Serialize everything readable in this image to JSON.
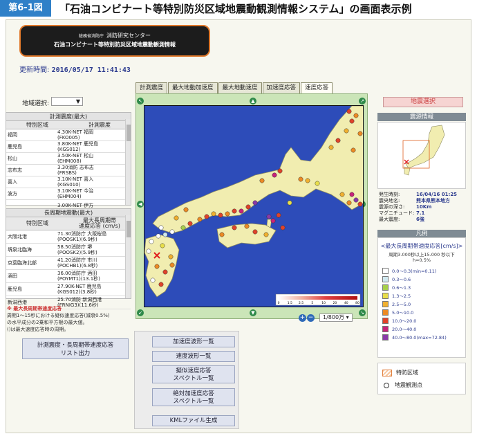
{
  "figure": {
    "tag": "第6-1図",
    "title": "「石油コンビナート等特別防災区域地震動観測情報システム」の画面表示例"
  },
  "banner": {
    "agency": "総務省消防庁",
    "org": "消防研究センター",
    "system": "石油コンビナート等特別防災区域地震動観測情報"
  },
  "updated": {
    "label": "更新時間:",
    "value": "2016/05/17 11:41:43"
  },
  "region_select": {
    "label": "地域選択:",
    "value": "▼"
  },
  "table1": {
    "caption": "計測震度(最大)",
    "headers": [
      "特別区域",
      "計測震度"
    ],
    "rows": [
      {
        "area": "福岡",
        "value": "4.30K-NET 福岡\n(FKO005)"
      },
      {
        "area": "鹿児島",
        "value": "3.80K-NET 鹿児島\n(KGS012)"
      },
      {
        "area": "松山",
        "value": "3.50K-NET 松山\n(EHM008)"
      },
      {
        "area": "志布志",
        "value": "3.30消防 志布志\n(FRSBS)"
      },
      {
        "area": "喜入",
        "value": "3.10K-NET 喜入\n(KGS010)"
      },
      {
        "area": "波方",
        "value": "3.10K-NET 今治\n(EHM004)"
      },
      {
        "area": "",
        "value": "3.00K-NET 伊方"
      }
    ]
  },
  "table2": {
    "caption": "長周期地震動(最大)",
    "headers": [
      "特別区域",
      "最大長周期帯\n速度応答 (cm/s)"
    ],
    "rows": [
      {
        "area": "大阪北港",
        "value": "71.30消防庁 大阪桜島\n(POOSK1)(6.9秒)"
      },
      {
        "area": "堺泉北臨海",
        "value": "58.50消防庁 堺\n(POOSK2)(5.9秒)"
      },
      {
        "area": "京葉臨海北部",
        "value": "41.20消防庁 市川\n(POCHB1)(6.8秒)"
      },
      {
        "area": "酒田",
        "value": "36.00消防庁 酒田\n(POYMT1)(13.1秒)"
      },
      {
        "area": "鹿児島",
        "value": "27.90K-NET 鹿児島\n(KGS012)(3.8秒)"
      },
      {
        "area": "新潟西港",
        "value": "25.70消防 新潟西港\n(FRNIG3)(11.6秒)"
      }
    ]
  },
  "note": {
    "title": "※ 最大長周期帯速度応答",
    "line1": "周期1〜15秒における疑似速度応答(減衰0.5%)",
    "line2": "の水平成分の2乗和平方根の最大値。",
    "line3": "()は最大速度応答時の周期。"
  },
  "left_button": {
    "label": "計測震度・長周期帯速度応答\nリスト出力"
  },
  "tabs": [
    "計測震度",
    "最大地動加速度",
    "最大地動速度",
    "加速度応答",
    "速度応答"
  ],
  "active_tab": 4,
  "map": {
    "scale_label": "1/800万",
    "colorbar_ticks": [
      "0",
      "1.5",
      "2.5",
      "5",
      "10",
      "20",
      "40",
      "80"
    ]
  },
  "wave_buttons": [
    "加速度波形一覧",
    "速度波形一覧",
    "擬似速度応答\nスペクトル一覧",
    "絶対加速度応答\nスペクトル一覧",
    "KMLファイル生成"
  ],
  "right": {
    "quake_button": "地震選択",
    "quake_info_header": "震源情報",
    "info": [
      {
        "label": "発生時刻:",
        "value": "16/04/16 01:25"
      },
      {
        "label": "震央地名:",
        "value": "熊本県熊本地方"
      },
      {
        "label": "震源の深さ:",
        "value": "10Km"
      },
      {
        "label": "マグニチュード:",
        "value": "7.1"
      },
      {
        "label": "最大震度:",
        "value": "6強"
      }
    ],
    "legend_header": "凡例",
    "legend_title": "<最大長周期帯速度応答[cm/s]>",
    "legend_sub": "周期3.000秒以上15.000 秒以下\nh=0.5%",
    "legend_items": [
      {
        "color": "#ffffff",
        "label": "0.0〜0.3(min=0.11)"
      },
      {
        "color": "#cfe8ef",
        "label": "0.3〜0.6"
      },
      {
        "color": "#a6cf4a",
        "label": "0.6〜1.3"
      },
      {
        "color": "#e8de4a",
        "label": "1.3〜2.5"
      },
      {
        "color": "#f0b030",
        "label": "2.5〜5.0"
      },
      {
        "color": "#ec8a24",
        "label": "5.0〜10.0"
      },
      {
        "color": "#e0432a",
        "label": "10.0〜20.0"
      },
      {
        "color": "#c8237a",
        "label": "20.0〜40.0"
      },
      {
        "color": "#8a3aa8",
        "label": "40.0〜80.0(max=72.84)"
      }
    ],
    "extra_legend": [
      {
        "label": "特防区域"
      },
      {
        "label": "地震観測点"
      }
    ]
  }
}
